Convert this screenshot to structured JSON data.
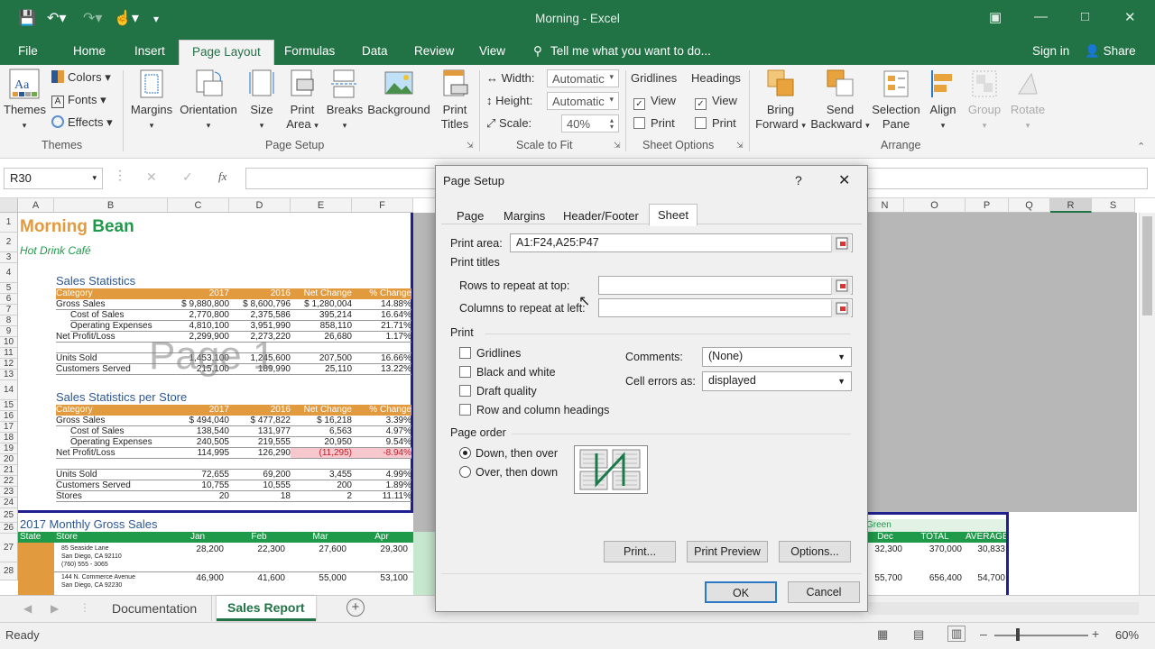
{
  "app": {
    "window_title": "Morning - Excel",
    "sign_in": "Sign in",
    "share": "Share"
  },
  "menu": {
    "tabs": [
      "File",
      "Home",
      "Insert",
      "Page Layout",
      "Formulas",
      "Data",
      "Review",
      "View"
    ],
    "active": "Page Layout",
    "tell_me": "Tell me what you want to do..."
  },
  "ribbon": {
    "themes": {
      "themes": "Themes",
      "colors": "Colors",
      "fonts": "Fonts",
      "effects": "Effects",
      "group": "Themes"
    },
    "page_setup": {
      "margins": "Margins",
      "orientation": "Orientation",
      "size": "Size",
      "print_area_1": "Print",
      "print_area_2": "Area",
      "breaks": "Breaks",
      "background": "Background",
      "print_titles_1": "Print",
      "print_titles_2": "Titles",
      "group": "Page Setup"
    },
    "scale": {
      "width_label": "Width:",
      "width_value": "Automatic",
      "height_label": "Height:",
      "height_value": "Automatic",
      "scale_label": "Scale:",
      "scale_value": "40%",
      "group": "Scale to Fit"
    },
    "sheet_options": {
      "gridlines": "Gridlines",
      "headings": "Headings",
      "view": "View",
      "print": "Print",
      "group": "Sheet Options"
    },
    "arrange": {
      "bring_forward_1": "Bring",
      "bring_forward_2": "Forward",
      "send_backward_1": "Send",
      "send_backward_2": "Backward",
      "selection_pane_1": "Selection",
      "selection_pane_2": "Pane",
      "align": "Align",
      "group_btn": "Group",
      "rotate": "Rotate",
      "group": "Arrange"
    }
  },
  "formula_bar": {
    "name_box": "R30",
    "fx": "fx",
    "value": ""
  },
  "columns": [
    "A",
    "B",
    "C",
    "D",
    "E",
    "F",
    "N",
    "O",
    "P",
    "Q",
    "R",
    "S"
  ],
  "rows": [
    "1",
    "2",
    "3",
    "4",
    "5",
    "6",
    "7",
    "8",
    "9",
    "10",
    "11",
    "12",
    "13",
    "14",
    "15",
    "16",
    "17",
    "18",
    "19",
    "20",
    "21",
    "22",
    "23",
    "24",
    "25",
    "26",
    "27",
    "28"
  ],
  "sheet": {
    "title1": "Morning",
    "title2": "Bean",
    "subtitle": "Hot Drink Café",
    "page_watermark": "Page 1",
    "sec1": "Sales Statistics",
    "sec2": "Sales Statistics per Store",
    "sec3": "2017 Monthly Gross Sales",
    "header1": [
      "Category",
      "2017",
      "2016",
      "Net Change",
      "% Change"
    ],
    "table1": [
      [
        "Gross Sales",
        "$ 9,880,800",
        "$ 8,600,796",
        "$ 1,280,004",
        "14.88%"
      ],
      [
        "Cost of Sales",
        "2,770,800",
        "2,375,586",
        "395,214",
        "16.64%"
      ],
      [
        "Operating Expenses",
        "4,810,100",
        "3,951,990",
        "858,110",
        "21.71%"
      ],
      [
        "Net Profit/Loss",
        "2,299,900",
        "2,273,220",
        "26,680",
        "1.17%"
      ],
      [
        "",
        "",
        " ",
        "",
        ""
      ],
      [
        "Units Sold",
        "1,453,100",
        "1,245,600",
        "207,500",
        "16.66%"
      ],
      [
        "Customers Served",
        "215,100",
        "189,990",
        "25,110",
        "13.22%"
      ]
    ],
    "table2": [
      [
        "Gross Sales",
        "$ 494,040",
        "$ 477,822",
        "$ 16,218",
        "3.39%"
      ],
      [
        "Cost of Sales",
        "138,540",
        "131,977",
        "6,563",
        "4.97%"
      ],
      [
        "Operating Expenses",
        "240,505",
        "219,555",
        "20,950",
        "9.54%"
      ],
      [
        "Net Profit/Loss",
        "114,995",
        "126,290",
        "(11,295)",
        "-8.94%"
      ],
      [
        "",
        "",
        "",
        "",
        ""
      ],
      [
        "Units Sold",
        "72,655",
        "69,200",
        "3,455",
        "4.99%"
      ],
      [
        "Customers Served",
        "10,755",
        "10,555",
        "200",
        "1.89%"
      ],
      [
        "Stores",
        "20",
        "18",
        "2",
        "11.11%"
      ]
    ],
    "monthly_header": [
      "State",
      "Store",
      "Jan",
      "Feb",
      "Mar",
      "Apr"
    ],
    "monthly_right_header": [
      "Dec",
      "TOTAL",
      "AVERAGE"
    ],
    "green_label": "Green",
    "monthly_rows": [
      {
        "store": [
          "85 Seaside Lane",
          "San Diego, CA 92110",
          "(760) 555 - 3065"
        ],
        "vals": [
          "28,200",
          "22,300",
          "27,600",
          "29,300"
        ],
        "right": [
          "32,300",
          "370,000",
          "30,833"
        ]
      },
      {
        "store": [
          "144 N. Commerce Avenue",
          "San Diego, CA 92230",
          ""
        ],
        "vals": [
          "46,900",
          "41,600",
          "55,000",
          "53,100"
        ],
        "right": [
          "55,700",
          "656,400",
          "54,700"
        ]
      }
    ]
  },
  "sheet_tabs": {
    "tabs": [
      "Documentation",
      "Sales Report"
    ],
    "active": "Sales Report"
  },
  "status": {
    "ready": "Ready",
    "zoom": "60%"
  },
  "dialog": {
    "title": "Page Setup",
    "help": "?",
    "tabs": [
      "Page",
      "Margins",
      "Header/Footer",
      "Sheet"
    ],
    "active_tab": "Sheet",
    "print_area_label": "Print area:",
    "print_area_value": "A1:F24,A25:P47",
    "print_titles": "Print titles",
    "rows_repeat": "Rows to repeat at top:",
    "cols_repeat": "Columns to repeat at left:",
    "print_section": "Print",
    "gridlines": "Gridlines",
    "black_white": "Black and white",
    "draft": "Draft quality",
    "row_col_headings": "Row and column headings",
    "comments_label": "Comments:",
    "comments_value": "(None)",
    "errors_label": "Cell errors as:",
    "errors_value": "displayed",
    "page_order": "Page order",
    "down_over": "Down, then over",
    "over_down": "Over, then down",
    "print_btn": "Print...",
    "preview_btn": "Print Preview",
    "options_btn": "Options...",
    "ok": "OK",
    "cancel": "Cancel"
  },
  "colors": {
    "excel_green": "#217346",
    "orange": "#e29a3f",
    "table_green": "#1f9a4a",
    "navy_border": "#1f1f8f"
  }
}
